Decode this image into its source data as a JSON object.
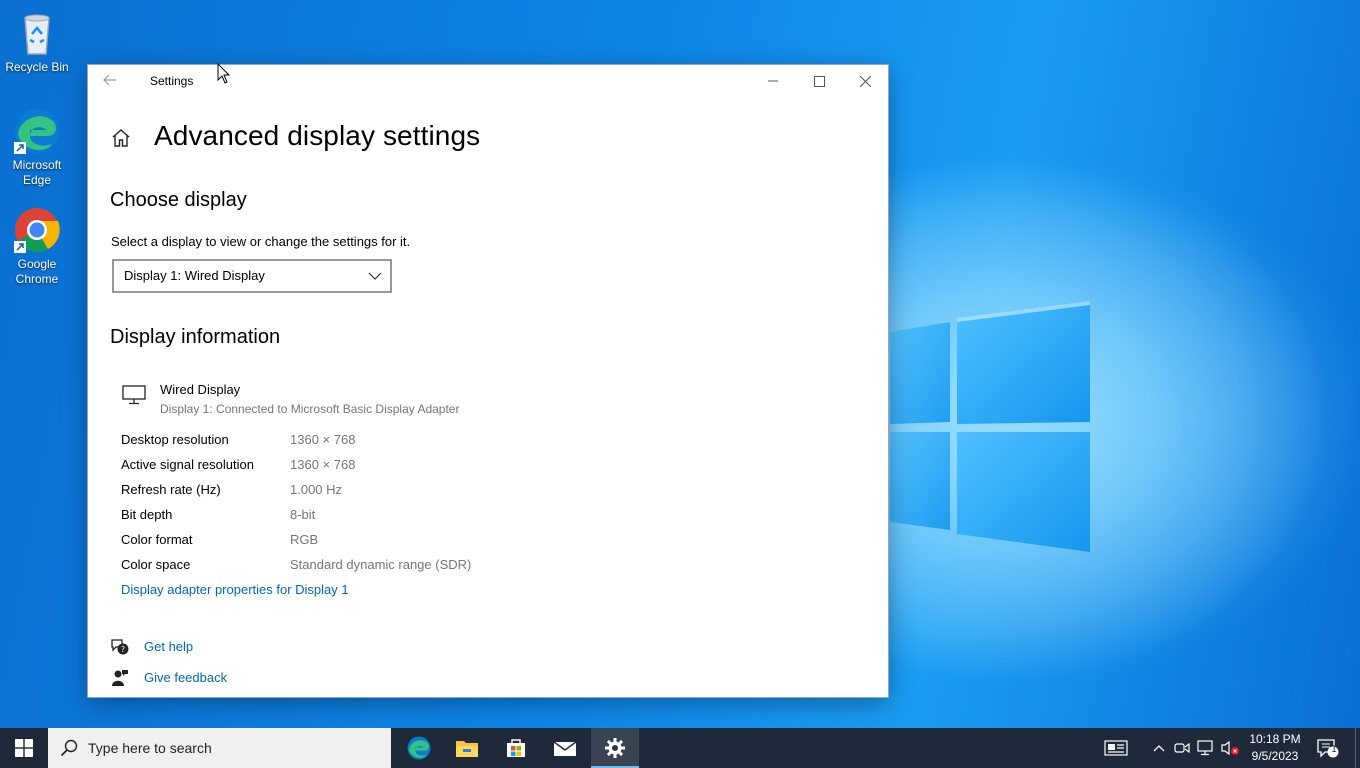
{
  "desktop": {
    "icons": [
      {
        "label": "Recycle Bin",
        "icon": "recycle-bin-icon"
      },
      {
        "label": "Microsoft Edge",
        "icon": "edge-icon"
      },
      {
        "label": "Google Chrome",
        "icon": "chrome-icon"
      }
    ]
  },
  "window": {
    "title": "Settings",
    "back_icon": "back-arrow-icon",
    "controls": [
      "minimize-icon",
      "maximize-icon",
      "close-icon"
    ]
  },
  "page": {
    "title": "Advanced display settings",
    "home_icon": "home-icon",
    "choose_display": {
      "heading": "Choose display",
      "description": "Select a display to view or change the settings for it.",
      "selected": "Display 1: Wired Display"
    },
    "display_info": {
      "heading": "Display information",
      "name": "Wired Display",
      "subtitle": "Display 1: Connected to Microsoft Basic Display Adapter",
      "rows": [
        {
          "key": "Desktop resolution",
          "value": "1360 × 768"
        },
        {
          "key": "Active signal resolution",
          "value": "1360 × 768"
        },
        {
          "key": "Refresh rate (Hz)",
          "value": "1.000 Hz"
        },
        {
          "key": "Bit depth",
          "value": "8-bit"
        },
        {
          "key": "Color format",
          "value": "RGB"
        },
        {
          "key": "Color space",
          "value": "Standard dynamic range (SDR)"
        }
      ],
      "adapter_link": "Display adapter properties for Display 1"
    },
    "help": {
      "get_help": "Get help",
      "give_feedback": "Give feedback"
    }
  },
  "taskbar": {
    "search_placeholder": "Type here to search",
    "apps": [
      "edge-icon",
      "file-explorer-icon",
      "store-icon",
      "mail-icon",
      "settings-gear-icon"
    ],
    "clock_time": "10:18 PM",
    "clock_date": "9/5/2023",
    "notification_count": "1"
  },
  "colors": {
    "accent_link": "#0067b8",
    "taskbar": "#1e2a3a",
    "secondary_text": "#767676"
  }
}
